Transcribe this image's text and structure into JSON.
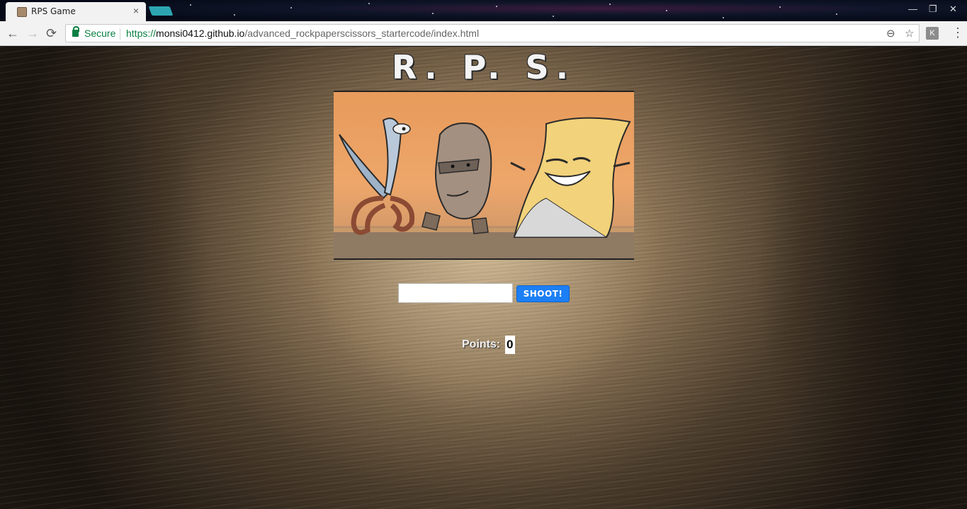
{
  "browser": {
    "tab_title": "RPS Game",
    "tab_close": "×",
    "secure_label": "Secure",
    "url_scheme": "https://",
    "url_host": "monsi0412.github.io",
    "url_path": "/advanced_rockpaperscissors_startercode/index.html",
    "icons": {
      "back": "←",
      "forward": "→",
      "reload": "⟳",
      "zoom": "⊖",
      "bookmark": "☆",
      "extension": "K",
      "menu": "⋮",
      "minimize": "—",
      "restore": "❐",
      "close": "✕"
    }
  },
  "game": {
    "logo_text": "R. P. S.",
    "shoot_input_value": "",
    "shoot_button_label": "SHOOT!",
    "points_label": "Points:",
    "points_value": "0"
  },
  "colors": {
    "secure_green": "#0b8043",
    "shoot_button": "#1c7ff5",
    "tab_accent": "#2ea5b2"
  }
}
